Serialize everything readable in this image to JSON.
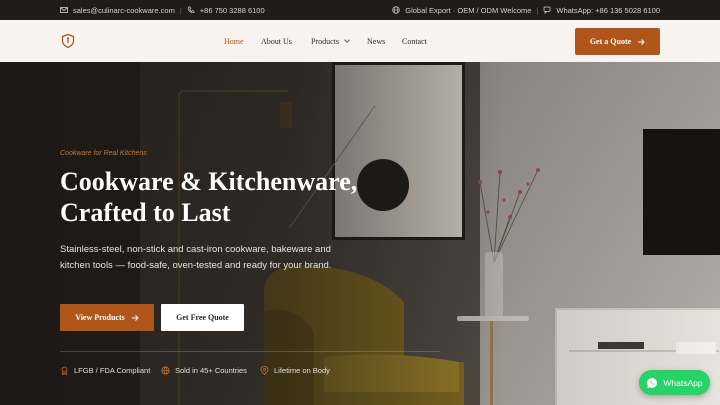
{
  "topbar": {
    "email": "sales@culinarc-cookware.com",
    "phone": "+86 750 3288 6100",
    "tagline": "Global Export · OEM / ODM Welcome",
    "whatsapp": "WhatsApp: +86 136 5028 6100",
    "icons": [
      "mail-icon",
      "phone-icon",
      "globe-icon",
      "whatsapp-icon"
    ]
  },
  "header": {
    "nav": [
      {
        "label": "Home",
        "active": true
      },
      {
        "label": "About Us"
      },
      {
        "label": "Products"
      },
      {
        "label": "News"
      },
      {
        "label": "Contact"
      }
    ],
    "cta": "Get a Quote"
  },
  "hero": {
    "eyebrow": "Cookware for Real Kitchens",
    "title_line1": "Cookware & Kitchenware,",
    "title_line2": "Crafted to Last",
    "subtitle": "Stainless-steel, non-stick and cast-iron cookware, bakeware and kitchen tools — food-safe, oven-tested and ready for your brand.",
    "primary_cta": "View Products",
    "secondary_cta": "Get Free Quote",
    "badges": [
      "LFGB / FDA Compliant",
      "Sold in 45+ Countries",
      "Lifetime on Body"
    ]
  },
  "whatsapp_button": "WhatsApp",
  "colors": {
    "accent": "#b0561a",
    "topbar_bg": "#1f1c1a",
    "header_bg": "#f7f3ee",
    "whatsapp": "#25d366"
  }
}
